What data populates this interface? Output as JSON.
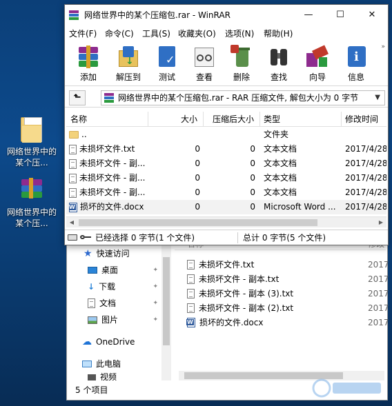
{
  "desktop": {
    "icons": [
      {
        "label": "网络世界中的某个压...",
        "icon": "folder-icon"
      },
      {
        "label": "网络世界中的某个压...",
        "icon": "winrar-archive-icon"
      }
    ]
  },
  "winrar": {
    "title": "网络世界中的某个压缩包.rar - WinRAR",
    "window_controls": {
      "minimize": "—",
      "maximize": "☐",
      "close": "✕"
    },
    "menu": [
      "文件(F)",
      "命令(C)",
      "工具(S)",
      "收藏夹(O)",
      "选项(N)",
      "帮助(H)"
    ],
    "toolbar": [
      "添加",
      "解压到",
      "测试",
      "查看",
      "删除",
      "查找",
      "向导",
      "信息"
    ],
    "toolbar_more": "»",
    "address": "网络世界中的某个压缩包.rar - RAR 压缩文件, 解包大小为 0 字节",
    "columns": {
      "name": "名称",
      "size": "大小",
      "packed": "压缩后大小",
      "type": "类型",
      "modified": "修改时间"
    },
    "rows": [
      {
        "name": "..",
        "size": "",
        "packed": "",
        "type": "文件夹",
        "modified": "",
        "icon": "folder"
      },
      {
        "name": "未损坏文件.txt",
        "size": "0",
        "packed": "0",
        "type": "文本文档",
        "modified": "2017/4/28",
        "icon": "text"
      },
      {
        "name": "未损坏文件 - 副...",
        "size": "0",
        "packed": "0",
        "type": "文本文档",
        "modified": "2017/4/28",
        "icon": "text"
      },
      {
        "name": "未损坏文件 - 副...",
        "size": "0",
        "packed": "0",
        "type": "文本文档",
        "modified": "2017/4/28",
        "icon": "text"
      },
      {
        "name": "未损坏文件 - 副...",
        "size": "0",
        "packed": "0",
        "type": "文本文档",
        "modified": "2017/4/28",
        "icon": "text"
      },
      {
        "name": "损坏的文件.docx",
        "size": "0",
        "packed": "0",
        "type": "Microsoft Word ...",
        "modified": "2017/4/28",
        "icon": "word"
      }
    ],
    "status_left": "已经选择 0 字节(1 个文件)",
    "status_right": "总计 0 字节(5 个文件)"
  },
  "explorer": {
    "column_name": "名称",
    "column_date": "修改",
    "nav": [
      {
        "label": "快速访问",
        "icon": "star-icon",
        "pinned": false
      },
      {
        "label": "桌面",
        "icon": "desktop-icon",
        "pinned": true
      },
      {
        "label": "下载",
        "icon": "download-icon",
        "pinned": true
      },
      {
        "label": "文档",
        "icon": "document-icon",
        "pinned": true
      },
      {
        "label": "图片",
        "icon": "picture-icon",
        "pinned": true
      },
      {
        "label": "OneDrive",
        "icon": "cloud-icon",
        "pinned": false
      },
      {
        "label": "此电脑",
        "icon": "computer-icon",
        "pinned": false
      },
      {
        "label": "视频",
        "icon": "video-icon",
        "pinned": false
      }
    ],
    "pin_glyph": "📌",
    "files": [
      {
        "name": "未损坏文件.txt",
        "date": "2017",
        "icon": "text"
      },
      {
        "name": "未损坏文件 - 副本.txt",
        "date": "2017",
        "icon": "text"
      },
      {
        "name": "未损坏文件 - 副本 (3).txt",
        "date": "2017",
        "icon": "text"
      },
      {
        "name": "未损坏文件 - 副本 (2).txt",
        "date": "2017",
        "icon": "text"
      },
      {
        "name": "损坏的文件.docx",
        "date": "2017",
        "icon": "word"
      }
    ],
    "status": "5 个项目"
  },
  "colors": {
    "desktop_bg": "#0d4a8c",
    "selection": "#f2f2f2",
    "onedrive": "#1e73d6"
  }
}
